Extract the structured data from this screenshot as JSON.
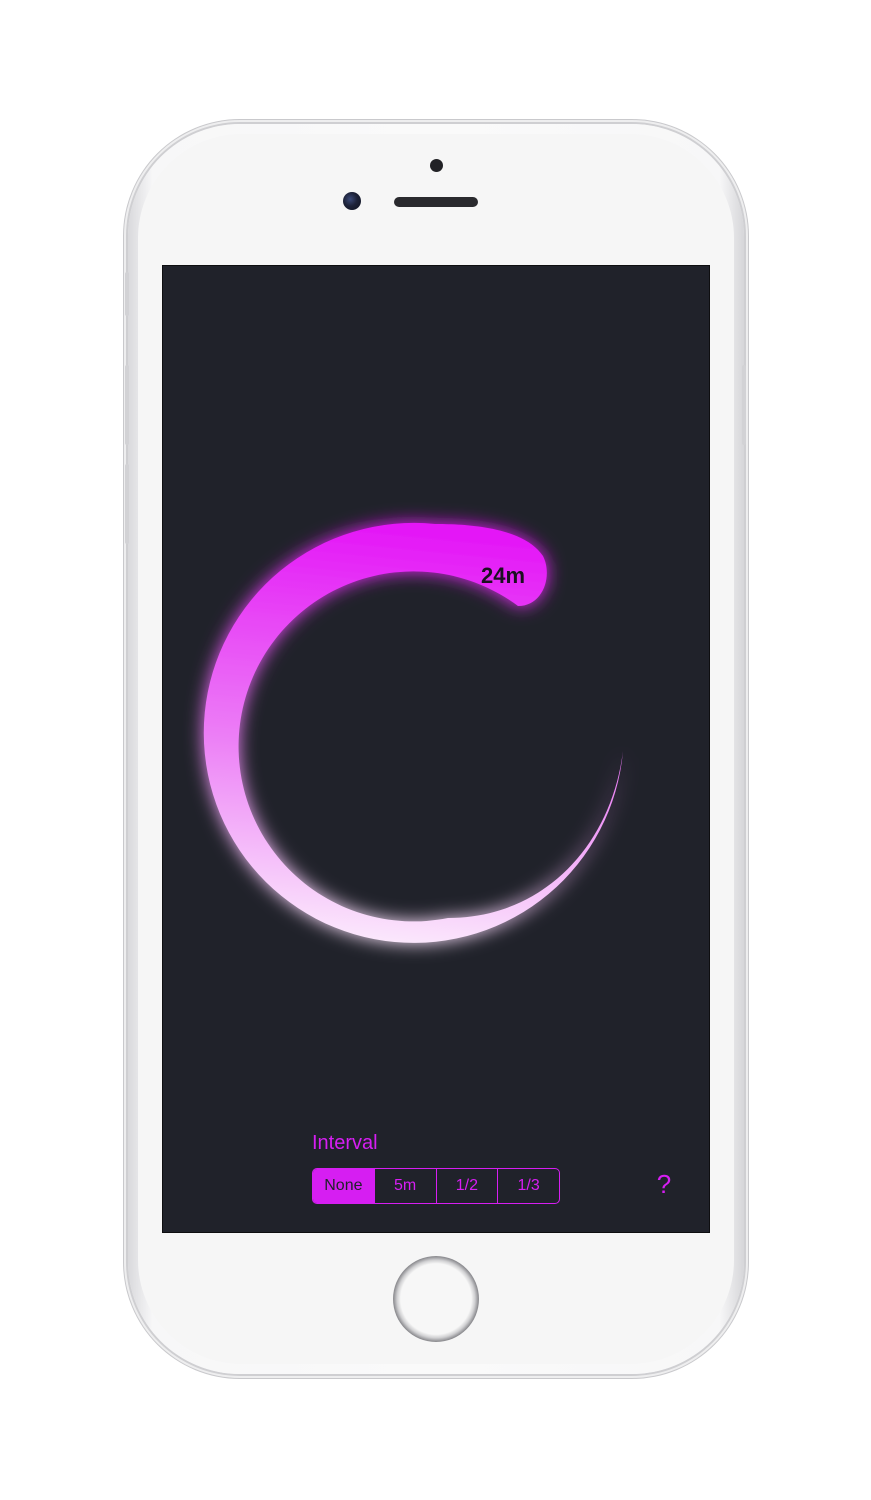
{
  "timer": {
    "remaining_label": "24m"
  },
  "interval": {
    "title": "Interval",
    "options": [
      "None",
      "5m",
      "1/2",
      "1/3"
    ],
    "selected": "None"
  },
  "help": {
    "label": "?"
  },
  "colors": {
    "accent": "#d61ef2",
    "screen_background": "#20222a",
    "ring_light": "#f6c3f8",
    "ring_bright": "#e412f7"
  },
  "icons": {
    "help": "question-mark-icon"
  }
}
